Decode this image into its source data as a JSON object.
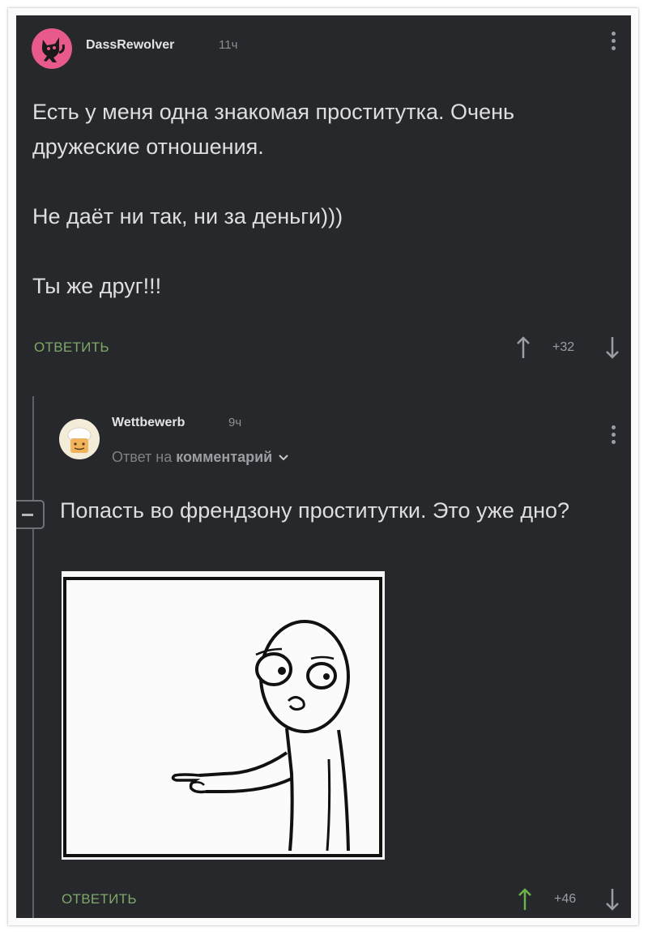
{
  "comments": [
    {
      "username": "DassRewolver",
      "time": "11ч",
      "text": "Есть у меня одна знакомая проститутка. Очень дружеские отношения.\n\nНе даёт ни так, ни за деньги)))\n\nТы же друг!!!",
      "reply_label": "ОТВЕТИТЬ",
      "score": "+32",
      "avatar_icon": "black-cat-on-pink-icon"
    },
    {
      "username": "Wettbewerb",
      "time": "9ч",
      "reply_to_prefix": "Ответ на",
      "reply_to_link": "комментарий",
      "text": "Попасть во френдзону проститутки. Это уже дно?",
      "reply_label": "ОТВЕТИТЬ",
      "score": "+46",
      "avatar_icon": "cartoon-chef-icon",
      "image": "rage-comic-pointing-worried-face"
    }
  ],
  "colors": {
    "background": "#26282c",
    "text": "#dedede",
    "reply_link": "#7fa86a",
    "upvote_active": "#6cb24a",
    "avatar_pink": "#e85a8c"
  }
}
